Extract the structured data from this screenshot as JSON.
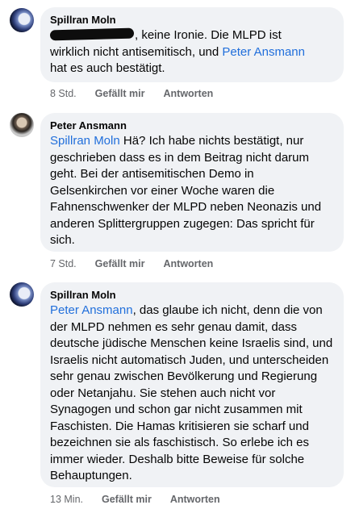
{
  "comments": [
    {
      "author": "Spillran Moln",
      "text_lines": [
        ", keine Ironie. Die MLPD ist",
        "wirklich nicht antisemitisch, und ",
        "hat es auch bestätigt."
      ],
      "mention": "Peter Ansmann",
      "time": "8 Std.",
      "like_label": "Gefällt mir",
      "reply_label": "Antworten"
    },
    {
      "author": "Peter Ansmann",
      "mention": "Spillran Moln",
      "text": " Hä? Ich habe nichts bestätigt, nur geschrieben dass es in dem Beitrag nicht darum geht. Bei der antisemitischen Demo in Gelsenkirchen vor einer Woche waren die Fahnenschwenker der MLPD neben Neonazis und anderen Splittergruppen zugegen: Das spricht für sich.",
      "time": "7 Std.",
      "like_label": "Gefällt mir",
      "reply_label": "Antworten"
    },
    {
      "author": "Spillran Moln",
      "mention": "Peter Ansmann",
      "text": ", das glaube ich nicht, denn die von der MLPD nehmen es sehr genau damit, dass deutsche jüdische Menschen keine Israelis sind, und Israelis nicht automatisch Juden, und unterscheiden sehr genau zwischen Bevölkerung und Regierung oder Netanjahu. Sie stehen auch nicht vor Synagogen und schon gar nicht zusammen mit Faschisten. Die Hamas kritisieren sie scharf und bezeichnen sie als faschistisch. So erlebe ich es immer wieder. Deshalb bitte Beweise für solche Behauptungen.",
      "time": "13 Min.",
      "like_label": "Gefällt mir",
      "reply_label": "Antworten"
    }
  ]
}
